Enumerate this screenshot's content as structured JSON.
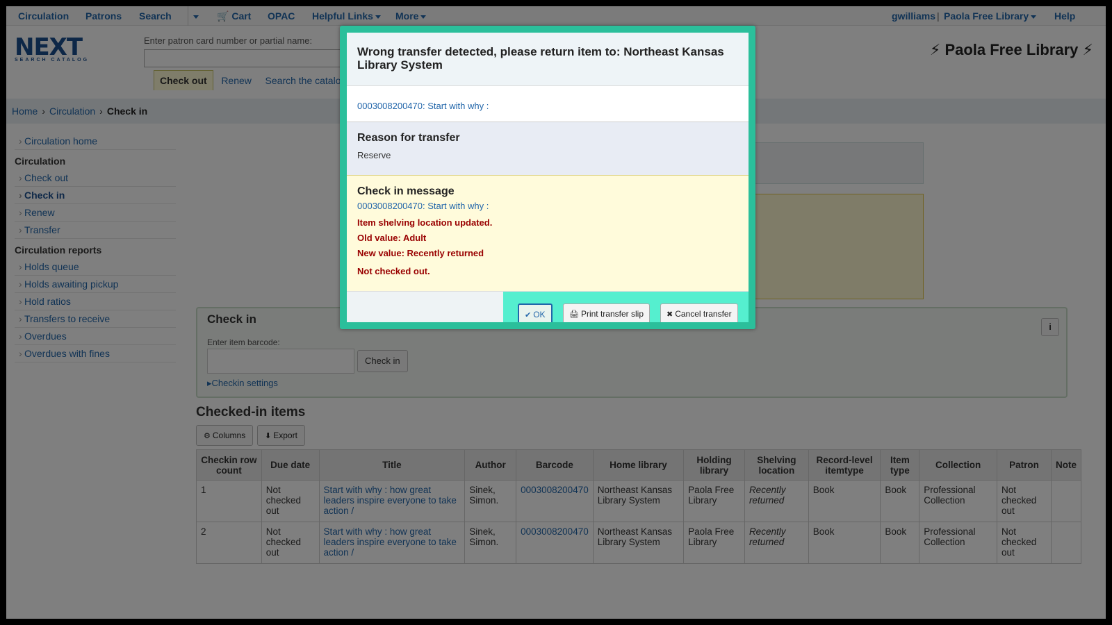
{
  "topnav": {
    "items": [
      "Circulation",
      "Patrons",
      "Search",
      "Cart",
      "OPAC",
      "Helpful Links",
      "More"
    ],
    "user": "gwilliams",
    "library": "Paola Free Library",
    "help": "Help"
  },
  "header": {
    "logo_main": "NEXT",
    "logo_sub": "SEARCH CATALOG",
    "patron_label": "Enter patron card number or partial name:",
    "tabs": [
      "Check out",
      "Renew",
      "Search the catalog"
    ],
    "library_name": "Paola Free Library"
  },
  "breadcrumb": [
    "Home",
    "Circulation",
    "Check in"
  ],
  "sidebar": {
    "home": "Circulation home",
    "heading1": "Circulation",
    "circ_links": [
      "Check out",
      "Check in",
      "Renew",
      "Transfer"
    ],
    "heading2": "Circulation reports",
    "report_links": [
      "Holds queue",
      "Holds awaiting pickup",
      "Hold ratios",
      "Transfers to receive",
      "Overdues",
      "Overdues with fines"
    ]
  },
  "checkin": {
    "title": "Check in",
    "label": "Enter item barcode:",
    "button": "Check in",
    "settings": "Checkin settings",
    "info": "i"
  },
  "checked_items": {
    "title": "Checked-in items",
    "columns_btn": "Columns",
    "export_btn": "Export",
    "headers": [
      "Checkin row count",
      "Due date",
      "Title",
      "Author",
      "Barcode",
      "Home library",
      "Holding library",
      "Shelving location",
      "Record-level itemtype",
      "Item type",
      "Collection",
      "Patron",
      "Note"
    ],
    "rows": [
      [
        "1",
        "Not checked out",
        "Start with why : how great leaders inspire everyone to take action /",
        "Sinek, Simon.",
        "0003008200470",
        "Northeast Kansas Library System",
        "Paola Free Library",
        "Recently returned",
        "Book",
        "Book",
        "Professional Collection",
        "Not checked out",
        ""
      ],
      [
        "2",
        "Not checked out",
        "Start with why : how great leaders inspire everyone to take action /",
        "Sinek, Simon.",
        "0003008200470",
        "Northeast Kansas Library System",
        "Paola Free Library",
        "Recently returned",
        "Book",
        "Book",
        "Professional Collection",
        "Not checked out",
        ""
      ]
    ]
  },
  "modal": {
    "title": "Wrong transfer detected, please return item to: Northeast Kansas Library System",
    "item_link": "0003008200470: Start with why :",
    "reason_heading": "Reason for transfer",
    "reason_value": "Reserve",
    "msg_heading": "Check in message",
    "msg_item_link": "0003008200470: Start with why :",
    "msg_line1": "Item shelving location updated.",
    "msg_line2": "Old value: Adult",
    "msg_line3": "New value: Recently returned",
    "msg_line4": "Not checked out.",
    "ok_btn": "OK",
    "print_btn": "Print transfer slip",
    "cancel_btn": "Cancel transfer"
  },
  "colors": {
    "link": "#2266aa",
    "modal_border": "#2bbf9b",
    "button_zone": "#55efcf",
    "error": "#990000"
  }
}
